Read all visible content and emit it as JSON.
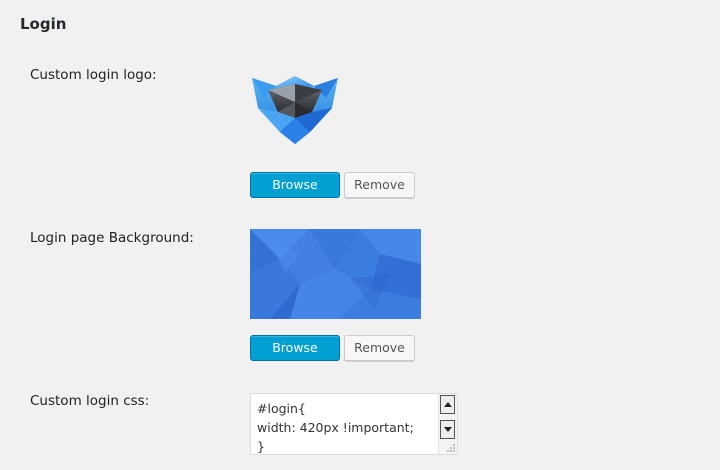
{
  "section": {
    "title": "Login"
  },
  "fields": {
    "logo": {
      "label": "Custom login logo:",
      "browse_label": "Browse",
      "remove_label": "Remove"
    },
    "background": {
      "label": "Login page Background:",
      "browse_label": "Browse",
      "remove_label": "Remove"
    },
    "css": {
      "label": "Custom login css:",
      "value": "#login{\nwidth: 420px !important;\n}"
    }
  },
  "colors": {
    "primary_button": "#00a0d2",
    "page_background": "#f1f1f1",
    "preview_blue": "#3d7fe0"
  }
}
